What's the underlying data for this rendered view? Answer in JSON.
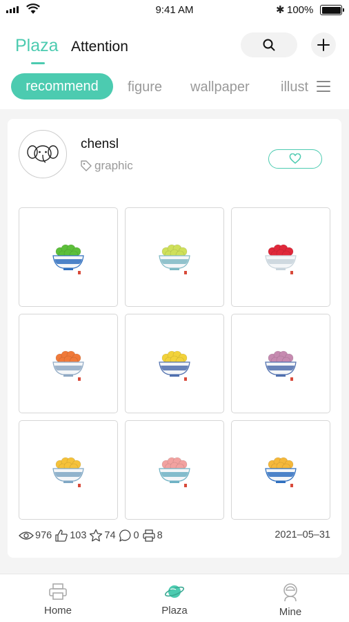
{
  "status_bar": {
    "time": "9:41 AM",
    "battery": "100%",
    "bluetooth": "✱"
  },
  "header": {
    "tabs": [
      {
        "label": "Plaza",
        "active": true
      },
      {
        "label": "Attention",
        "active": false
      }
    ],
    "search_icon": "search-icon",
    "add_icon": "plus-icon"
  },
  "categories": [
    {
      "label": "recommend",
      "active": true
    },
    {
      "label": "figure",
      "active": false
    },
    {
      "label": "wallpaper",
      "active": false
    },
    {
      "label": "illust",
      "active": false
    }
  ],
  "post": {
    "username": "chensl",
    "tag": "graphic",
    "images": [
      {
        "name": "bowl-green-fruit",
        "fruit": "#5cbf3a",
        "bowl": "#2f6fbf"
      },
      {
        "name": "bowl-yellow-fruit",
        "fruit": "#cfe05a",
        "bowl": "#7fb9c4"
      },
      {
        "name": "bowl-red-cherries",
        "fruit": "#e0283a",
        "bowl": "#c8d4dc"
      },
      {
        "name": "bowl-orange-fruit",
        "fruit": "#f07a3a",
        "bowl": "#8fa9c4"
      },
      {
        "name": "bowl-yellow-pears",
        "fruit": "#f2d23a",
        "bowl": "#4f6fae"
      },
      {
        "name": "bowl-purple-fruit",
        "fruit": "#c68ab0",
        "bowl": "#4f6fae"
      },
      {
        "name": "bowl-mango-fruit",
        "fruit": "#f5c23a",
        "bowl": "#7fa7c4"
      },
      {
        "name": "bowl-peach-fruit",
        "fruit": "#f2a2a0",
        "bowl": "#6fb2c4"
      },
      {
        "name": "bowl-apricot-fruit",
        "fruit": "#f5b83a",
        "bowl": "#2f6fbf"
      }
    ],
    "stats": {
      "views": "976",
      "likes": "103",
      "favorites": "74",
      "comments": "0",
      "prints": "8"
    },
    "date": "2021–05–31"
  },
  "tabbar": [
    {
      "label": "Home",
      "icon": "printer-icon"
    },
    {
      "label": "Plaza",
      "icon": "planet-icon",
      "active": true
    },
    {
      "label": "Mine",
      "icon": "astronaut-icon"
    }
  ]
}
